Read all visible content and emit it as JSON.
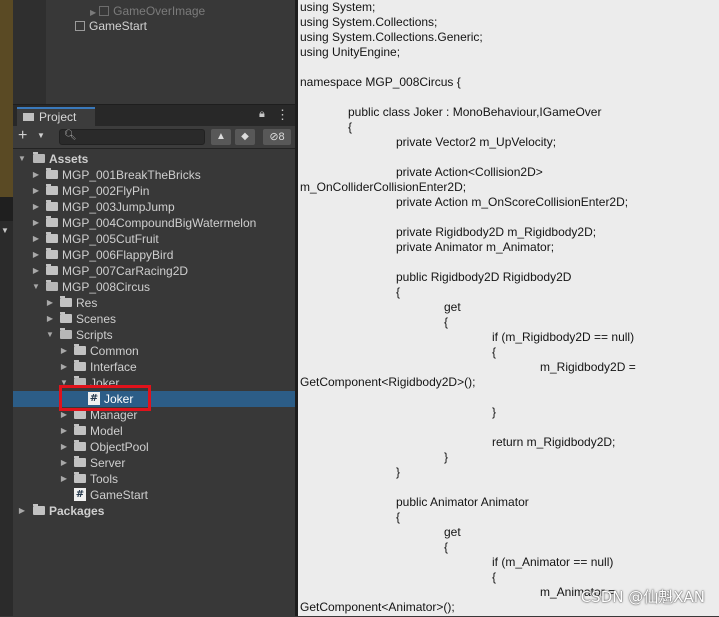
{
  "hierarchy": {
    "items": [
      {
        "label": "GameOverImage"
      },
      {
        "label": "GameStart"
      }
    ]
  },
  "project": {
    "tab_label": "Project",
    "hidden_count": "8",
    "search": {
      "value": "",
      "placeholder": ""
    },
    "tree": [
      {
        "label": "Assets"
      },
      {
        "label": "MGP_001BreakTheBricks"
      },
      {
        "label": "MGP_002FlyPin"
      },
      {
        "label": "MGP_003JumpJump"
      },
      {
        "label": "MGP_004CompoundBigWatermelon"
      },
      {
        "label": "MGP_005CutFruit"
      },
      {
        "label": "MGP_006FlappyBird"
      },
      {
        "label": "MGP_007CarRacing2D"
      },
      {
        "label": "MGP_008Circus"
      },
      {
        "label": "Res"
      },
      {
        "label": "Scenes"
      },
      {
        "label": "Scripts"
      },
      {
        "label": "Common"
      },
      {
        "label": "Interface"
      },
      {
        "label": "Joker"
      },
      {
        "label": "Joker"
      },
      {
        "label": "Manager"
      },
      {
        "label": "Model"
      },
      {
        "label": "ObjectPool"
      },
      {
        "label": "Server"
      },
      {
        "label": "Tools"
      },
      {
        "label": "GameStart"
      },
      {
        "label": "Packages"
      }
    ]
  },
  "code": {
    "lines": [
      "using System;",
      "using System.Collections;",
      "using System.Collections.Generic;",
      "using UnityEngine;",
      "",
      "namespace MGP_008Circus {",
      "",
      "public class Joker : MonoBehaviour,IGameOver",
      "{",
      "private Vector2 m_UpVelocity;",
      "",
      "private Action<Collision2D>",
      "m_OnColliderCollisionEnter2D;",
      "private Action m_OnScoreCollisionEnter2D;",
      "",
      "private Rigidbody2D m_Rigidbody2D;",
      "private Animator m_Animator;",
      "",
      "public Rigidbody2D Rigidbody2D",
      "{",
      "get",
      "{",
      "if (m_Rigidbody2D == null)",
      "{",
      "m_Rigidbody2D =",
      "GetComponent<Rigidbody2D>();",
      "",
      "}",
      "",
      "return m_Rigidbody2D;",
      "}",
      "}",
      "",
      "public Animator Animator",
      "{",
      "get",
      "{",
      "if (m_Animator == null)",
      "{",
      "m_Animator =",
      "GetComponent<Animator>();"
    ]
  },
  "watermark": "CSDN @仙魁XAN"
}
